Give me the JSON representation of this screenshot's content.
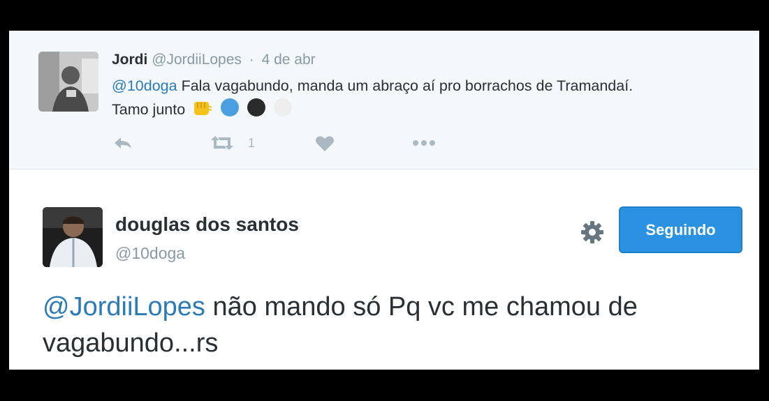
{
  "parent_tweet": {
    "name": "Jordi",
    "handle": "@JordiiLopes",
    "separator": "·",
    "date": "4 de abr",
    "mention": "@10doga",
    "text_line1": "Fala vagabundo, manda um abraço aí pro borrachos de Tramandaí.",
    "text_line2": "Tamo junto",
    "emojis": [
      "fist-icon",
      "blue-circle-icon",
      "black-circle-icon",
      "white-circle-icon"
    ],
    "retweet_count": "1"
  },
  "main_tweet": {
    "name": "douglas dos santos",
    "handle": "@10doga",
    "follow_label": "Seguindo",
    "mention": "@JordiiLopes",
    "text": "não mando só Pq vc me chamou de vagabundo...rs"
  },
  "colors": {
    "link": "#2b7bb9",
    "follow_button": "#2b92e2",
    "muted": "#8899a6",
    "text": "#292f33"
  }
}
